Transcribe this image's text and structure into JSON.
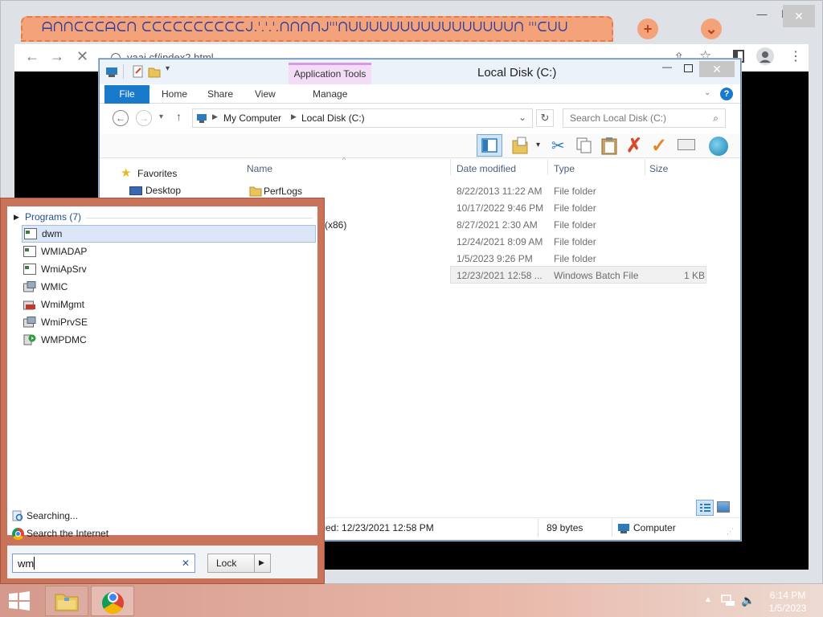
{
  "browser": {
    "tab_title": "ᗩᑎᑎᑕᑕᑕᗩᑕᑎ ᑕᑕᑕᑕᑕᑕᑕᑕᑕᑕᒍ.ᑊ.ᑊ.ᑊ.ᑎᑎᑎᑎᒍᑊᑊᑊᑎᑌᑌᑌᑌᑌᑌᑌᑌᑌᑌᑌᑌᑌᑌᑌᑌᑎ ᑊᑊᑊᑕᑌᑌ",
    "url": "vaai.cf/index2.html",
    "new_tab_glyph": "+",
    "dropdown_glyph": "⌄"
  },
  "explorer": {
    "title": "Local Disk (C:)",
    "app_tools": "Application Tools",
    "ribbon_tabs": {
      "file": "File",
      "home": "Home",
      "share": "Share",
      "view": "View",
      "manage": "Manage"
    },
    "breadcrumb": {
      "root": "My Computer",
      "current": "Local Disk (C:)"
    },
    "search_placeholder": "Search Local Disk (C:)",
    "nav": {
      "favorites": "Favorites",
      "desktop": "Desktop"
    },
    "columns": {
      "name": "Name",
      "date": "Date modified",
      "type": "Type",
      "size": "Size"
    },
    "rows": [
      {
        "name": "PerfLogs",
        "date": "8/22/2013 11:22 AM",
        "type": "File folder",
        "size": ""
      },
      {
        "name": "",
        "date": "10/17/2022 9:46 PM",
        "type": "File folder",
        "size": ""
      },
      {
        "name": "(x86)",
        "date": "8/27/2021 2:30 AM",
        "type": "File folder",
        "size": ""
      },
      {
        "name": "",
        "date": "12/24/2021 8:09 AM",
        "type": "File folder",
        "size": ""
      },
      {
        "name": "",
        "date": "1/5/2023 9:26 PM",
        "type": "File folder",
        "size": ""
      },
      {
        "name": "",
        "date": "12/23/2021 12:58 ...",
        "type": "Windows Batch File",
        "size": "1 KB"
      }
    ],
    "status": {
      "modified": "fied: 12/23/2021 12:58 PM",
      "size": "89 bytes",
      "location": "Computer"
    }
  },
  "start_search": {
    "group_label": "Programs (7)",
    "programs": [
      "dwm",
      "WMIADAP",
      "WmiApSrv",
      "WMIC",
      "WmiMgmt",
      "WmiPrvSE",
      "WMPDMC"
    ],
    "searching": "Searching...",
    "search_internet": "Search the Internet",
    "query": "wm",
    "lock_label": "Lock",
    "clear_glyph": "✕",
    "arrow_glyph": "▶"
  },
  "taskbar": {
    "time": "6:14 PM",
    "date": "1/5/2023"
  },
  "colors": {
    "file_tab": "#1979ca",
    "start_frame": "#c8735a",
    "app_tools": "#f3dcf5",
    "chrome_tab": "#f4a27a"
  }
}
